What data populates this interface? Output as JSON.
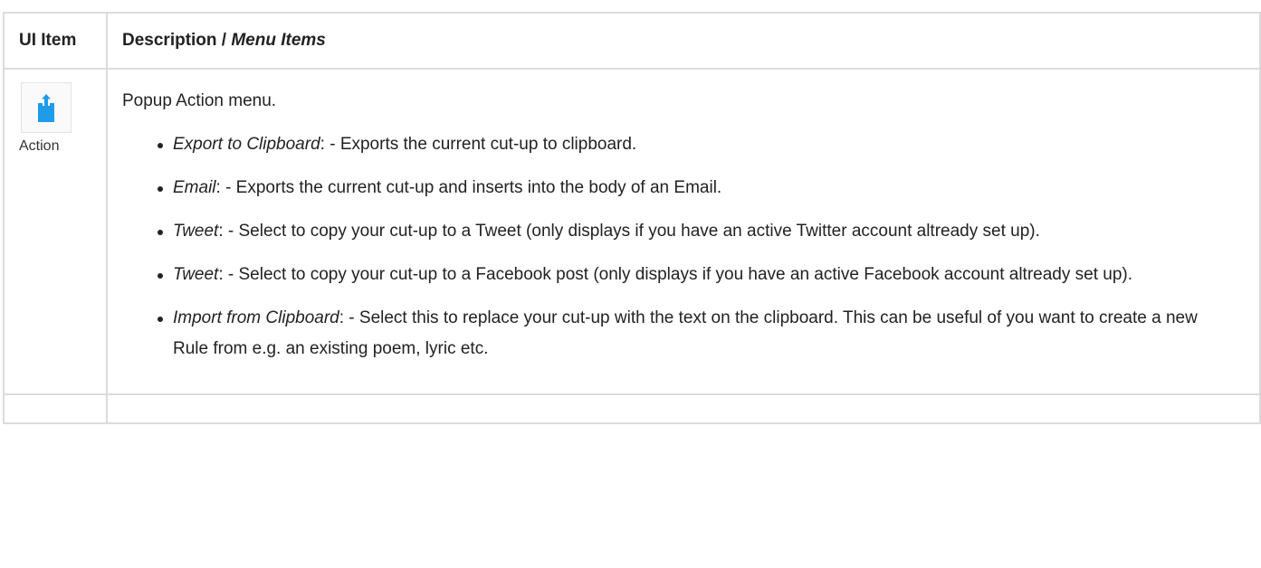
{
  "table": {
    "headers": {
      "ui_item": "UI Item",
      "description_prefix": "Description / ",
      "description_emphasis": "Menu Items"
    },
    "rows": [
      {
        "item_icon": "share-export-icon",
        "item_label": "Action",
        "intro": "Popup Action menu.",
        "menu_items": [
          {
            "name": "Export to Clipboard",
            "text": ": - Exports the current cut-up to clipboard."
          },
          {
            "name": "Email",
            "text": ": - Exports the current cut-up and inserts into the body of an Email."
          },
          {
            "name": "Tweet",
            "text": ": - Select to copy your cut-up to a Tweet (only displays if you have an active Twitter account altready set up)."
          },
          {
            "name": "Tweet",
            "text": ": - Select to copy your cut-up to a Facebook post (only displays if you have an active Facebook account altready set up)."
          },
          {
            "name": "Import from Clipboard",
            "text": ": - Select this to replace your cut-up with the text on the clipboard. This can be useful of you want to create a new Rule from e.g. an existing poem, lyric etc."
          }
        ]
      }
    ]
  },
  "colors": {
    "icon_accent": "#1e9be9",
    "border": "#dcdcdc",
    "text": "#222222"
  }
}
